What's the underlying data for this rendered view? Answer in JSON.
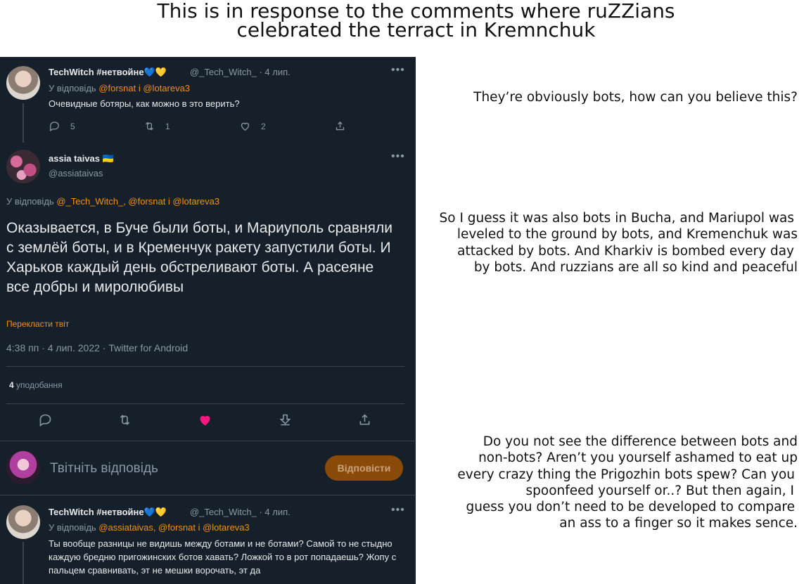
{
  "header": {
    "line1": "This is in response to the comments where ruZZians",
    "line2": "celebrated the terract in Kremnchuk"
  },
  "tweet1": {
    "name": "TechWitch #нетвойне💙💛",
    "meta": "@_Tech_Witch_ · 4 лип.",
    "reply_prefix": "У відповідь",
    "reply_mentions": "@forsnat і @lotareva3",
    "text": "Очевидные ботяры, как можно в это верить?",
    "replies": "5",
    "retweets": "1",
    "likes": "2"
  },
  "tweet2": {
    "name": "assia taivas 🇺🇦",
    "handle": "@assiataivas",
    "reply_prefix": "У відповідь",
    "reply_mentions": "@_Tech_Witch_, @forsnat і @lotareva3",
    "text": "Оказывается, в Буче были боты, и Мариуполь сравняли с землёй боты, и в Кременчук ракету запустили боты. И Харьков каждый день обстреливают боты. А расеяне все добры и миролюбивы",
    "translate": "Перекласти твіт",
    "timestamp": "4:38 пп · 4 лип. 2022 · Twitter for Android",
    "likes_count": "4",
    "likes_label": "уподобання"
  },
  "composer": {
    "placeholder": "Твітніть відповідь",
    "button": "Відповісти"
  },
  "tweet3": {
    "name": "TechWitch #нетвойне💙💛",
    "meta": "@_Tech_Witch_ · 4 лип.",
    "reply_prefix": "У відповідь",
    "reply_mentions": "@assiataivas, @forsnat і @lotareva3",
    "text": "Ты вообще разницы не видишь между ботами и не ботами? Самой то не стыдно каждую бредню пригожинских ботов хавать? Ложкой то в рот попадаешь? Жопу с пальцем сравнивать, эт не мешки ворочать, эт да"
  },
  "annotations": {
    "a1": "They’re obviously bots, how can you believe this?",
    "a2": [
      "So I guess it was also bots in Bucha, and Mariupol was",
      "leveled to the ground by bots, and Kremenchuk was",
      "attacked by bots. And Kharkiv is bombed every day",
      "by bots. And ruzzians are all so kind and peaceful"
    ],
    "a3": [
      "Do you not see the difference between bots and",
      "non-bots?  Aren’t you yourself ashamed to eat up",
      "every crazy thing the Prigozhin bots spew? Can you",
      "spoonfeed yourself or..? But then again, I",
      "guess you don’t need to be developed to compare",
      "an ass to a finger so it makes sence."
    ]
  },
  "colors": {
    "panel_bg": "#15202b",
    "accent": "#f4900c",
    "like_active": "#f91880"
  }
}
